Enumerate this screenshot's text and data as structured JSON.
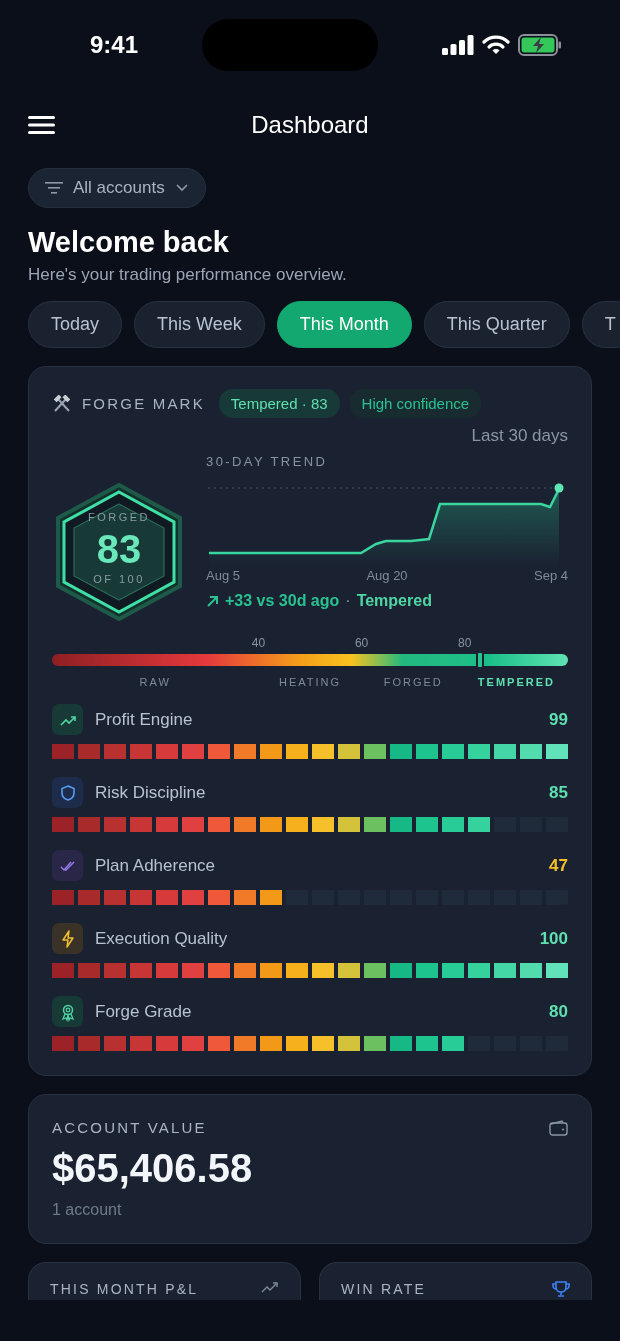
{
  "status_bar": {
    "time": "9:41"
  },
  "header": {
    "title": "Dashboard"
  },
  "account_filter": {
    "label": "All accounts"
  },
  "welcome": {
    "title": "Welcome back",
    "subtitle": "Here's your trading performance overview."
  },
  "periods": [
    {
      "label": "Today",
      "selected": false
    },
    {
      "label": "This Week",
      "selected": false
    },
    {
      "label": "This Month",
      "selected": true
    },
    {
      "label": "This Quarter",
      "selected": false
    },
    {
      "label": "T",
      "selected": false
    }
  ],
  "forge_card": {
    "title": "FORGE MARK",
    "badges": [
      "Tempered · 83",
      "High confidence"
    ],
    "range": "Last 30 days",
    "hex": {
      "top": "FORGED",
      "score": "83",
      "bottom": "OF 100"
    },
    "trend": {
      "title": "30-DAY TREND",
      "x_labels": [
        "Aug 5",
        "Aug 20",
        "Sep 4"
      ],
      "change": "+33 vs 30d ago",
      "separator": "·",
      "tier": "Tempered"
    },
    "scale": {
      "level": 0.83,
      "ticks": [
        "40",
        "60",
        "80"
      ],
      "bands": [
        {
          "label": "RAW",
          "selected": false
        },
        {
          "label": "HEATING",
          "selected": false
        },
        {
          "label": "FORGED",
          "selected": false
        },
        {
          "label": "TEMPERED",
          "selected": true
        }
      ]
    },
    "metrics": [
      {
        "name": "Profit Engine",
        "score": "99",
        "level": 1.0,
        "color": "#5ee0b0"
      },
      {
        "name": "Risk Discipline",
        "score": "85",
        "level": 0.85,
        "color": "#5ee0b0"
      },
      {
        "name": "Plan Adherence",
        "score": "47",
        "level": 0.45,
        "color": "#f5c02a"
      },
      {
        "name": "Execution Quality",
        "score": "100",
        "level": 1.0,
        "color": "#5ee0b0"
      },
      {
        "name": "Forge Grade",
        "score": "80",
        "level": 0.8,
        "color": "#5ee0b0"
      }
    ]
  },
  "account_value": {
    "title": "ACCOUNT VALUE",
    "value": "$65,406.58",
    "note": "1 account"
  },
  "stat_cards": [
    {
      "title": "THIS MONTH P&L"
    },
    {
      "title": "WIN RATE"
    }
  ]
}
